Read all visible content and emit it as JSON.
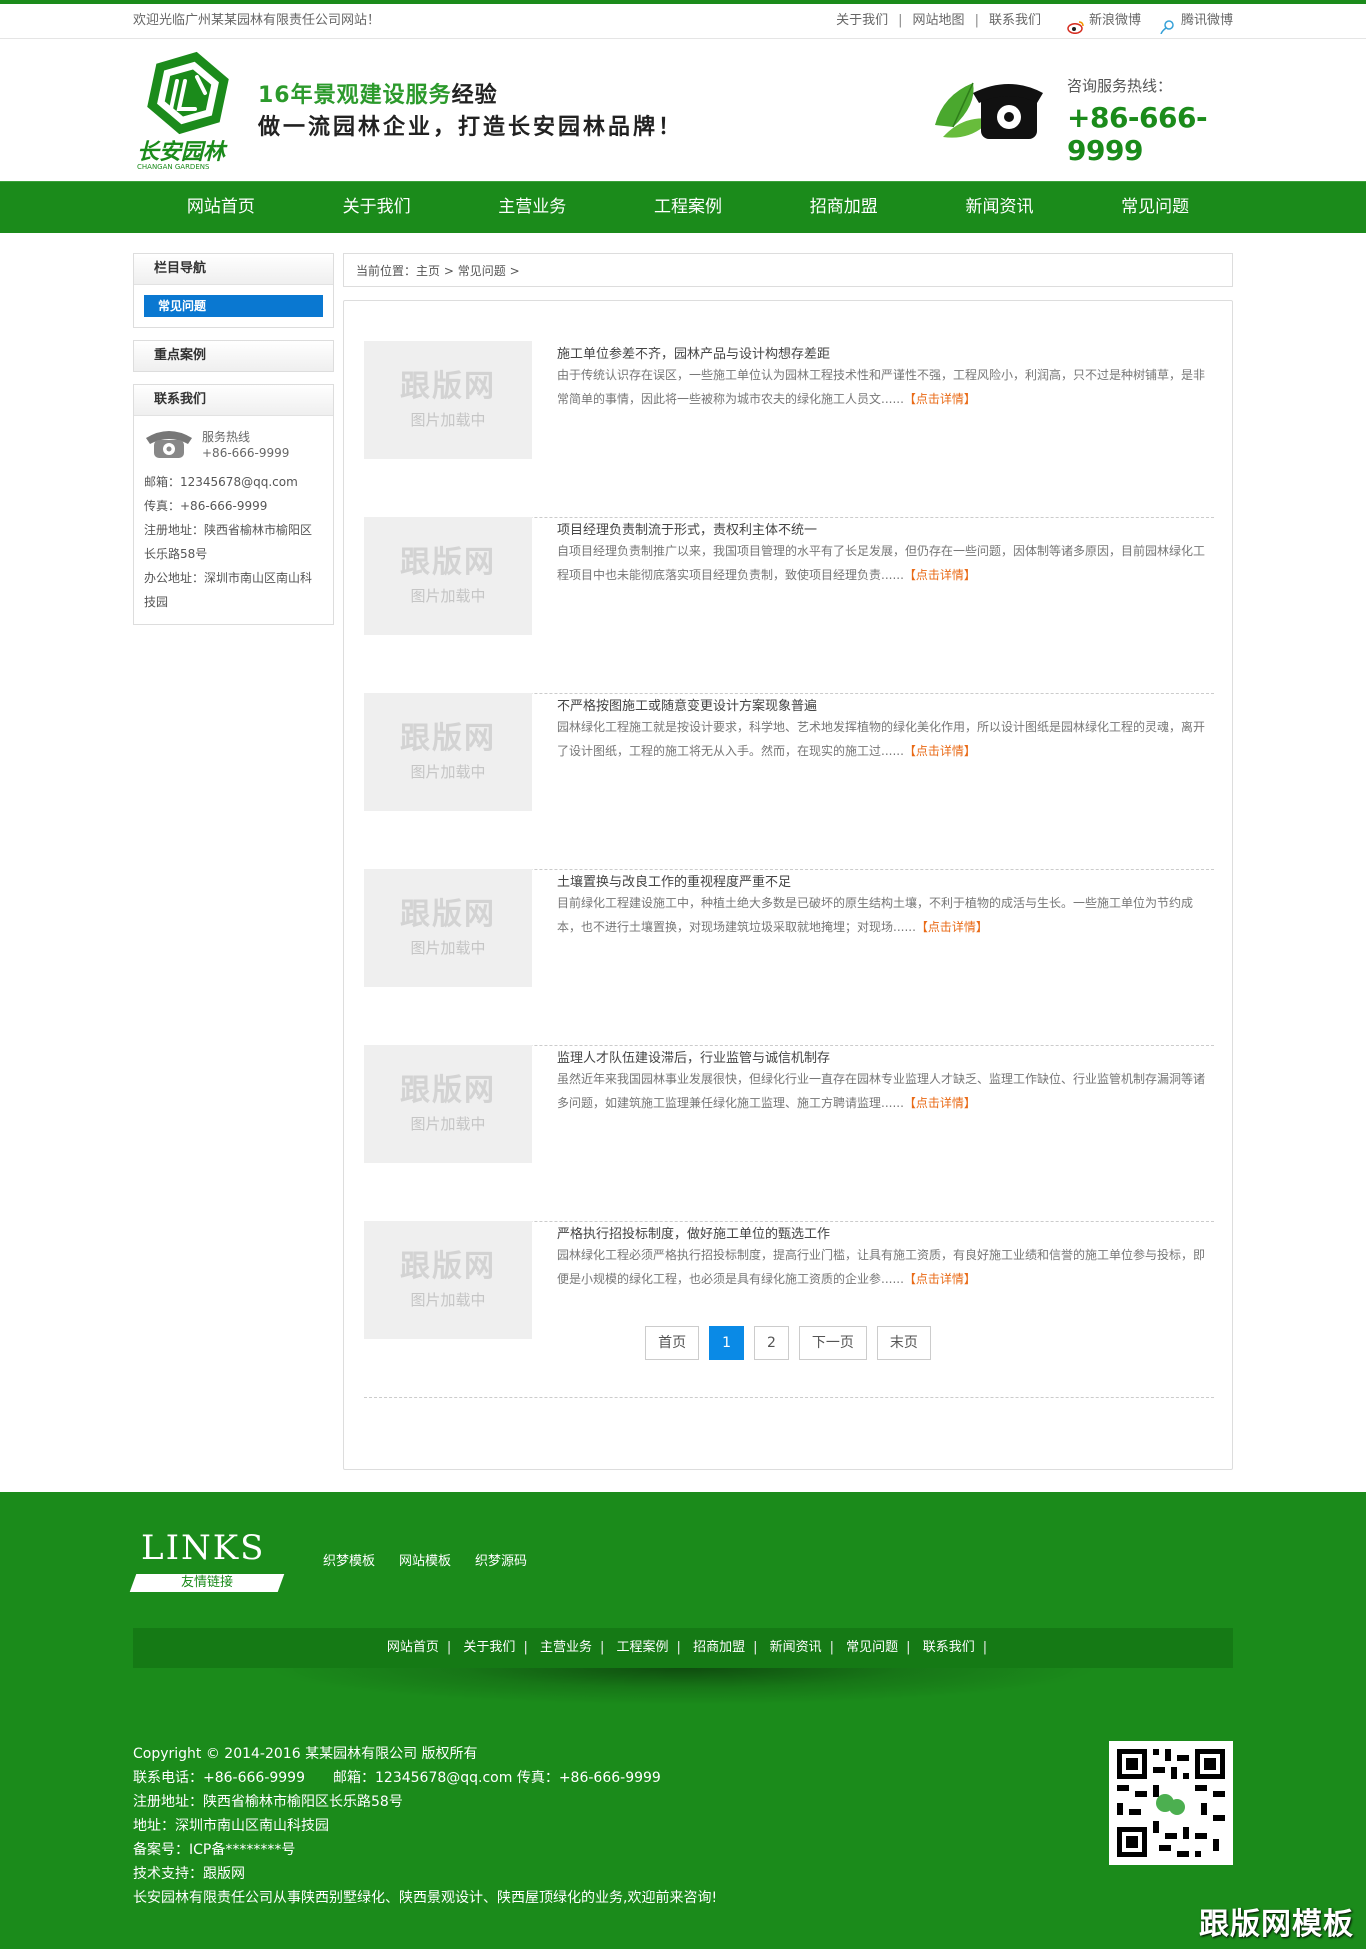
{
  "topbar": {
    "welcome": "欢迎光临广州某某园林有限责任公司网站！",
    "links": [
      "关于我们",
      "网站地图",
      "联系我们"
    ],
    "separator": "|",
    "weibo_sina": "新浪微博",
    "weibo_tencent": "腾讯微博"
  },
  "header": {
    "logo_text": "长安园林",
    "logo_sub": "CHANGAN GARDENS",
    "slogan_line1_a": "16年景观建设服务",
    "slogan_line1_b": "经验",
    "slogan_line2": "做一流园林企业，打造长安园林品牌！",
    "hotline_label": "咨询服务热线：",
    "hotline_number": "+86-666-9999"
  },
  "nav": [
    "网站首页",
    "关于我们",
    "主营业务",
    "工程案例",
    "招商加盟",
    "新闻资讯",
    "常见问题"
  ],
  "sidebar": {
    "nav_title": "栏目导航",
    "nav_current": "常见问题",
    "cases_title": "重点案例",
    "contact_title": "联系我们",
    "service_label": "服务热线",
    "service_phone": "+86-666-9999",
    "lines": [
      "邮箱：12345678@qq.com",
      "传真：+86-666-9999",
      "注册地址：陕西省榆林市榆阳区长乐路58号",
      "办公地址：深圳市南山区南山科技园"
    ]
  },
  "breadcrumb": {
    "prefix": "当前位置：",
    "home": "主页",
    "sep": ">",
    "current": "常见问题",
    "tail": ">"
  },
  "thumb_placeholder": {
    "line1": "跟版网",
    "line2": "图片加载中"
  },
  "more_label": "【点击详情】",
  "articles": [
    {
      "title": "施工单位参差不齐，园林产品与设计构想存差距",
      "summary": "由于传统认识存在误区，一些施工单位认为园林工程技术性和严谨性不强，工程风险小，利润高，只不过是种树铺草，是非常简单的事情，因此将一些被称为城市农夫的绿化施工人员文......"
    },
    {
      "title": "项目经理负责制流于形式，责权利主体不统一",
      "summary": "自项目经理负责制推广以来，我国项目管理的水平有了长足发展，但仍存在一些问题，因体制等诸多原因，目前园林绿化工程项目中也未能彻底落实项目经理负责制，致使项目经理负责......"
    },
    {
      "title": "不严格按图施工或随意变更设计方案现象普遍",
      "summary": "园林绿化工程施工就是按设计要求，科学地、艺术地发挥植物的绿化美化作用，所以设计图纸是园林绿化工程的灵魂，离开了设计图纸，工程的施工将无从入手。然而，在现实的施工过......"
    },
    {
      "title": "土壤置换与改良工作的重视程度严重不足",
      "summary": "目前绿化工程建设施工中，种植土绝大多数是已破坏的原生结构土壤，不利于植物的成活与生长。一些施工单位为节约成本，也不进行土壤置换，对现场建筑垃圾采取就地掩埋；对现场......"
    },
    {
      "title": "监理人才队伍建设滞后，行业监管与诚信机制存",
      "summary": "虽然近年来我国园林事业发展很快，但绿化行业一直存在园林专业监理人才缺乏、监理工作缺位、行业监管机制存漏洞等诸多问题，如建筑施工监理兼任绿化施工监理、施工方聘请监理......"
    },
    {
      "title": "严格执行招投标制度，做好施工单位的甄选工作",
      "summary": "园林绿化工程必须严格执行招投标制度，提高行业门槛，让具有施工资质，有良好施工业绩和信誉的施工单位参与投标，即便是小规模的绿化工程，也必须是具有绿化施工资质的企业参......"
    }
  ],
  "pager": {
    "first": "首页",
    "pages": [
      "1",
      "2"
    ],
    "current": "1",
    "next": "下一页",
    "last": "末页"
  },
  "footer": {
    "links_title": "LINKS",
    "links_sub": "友情链接",
    "friend_links": [
      "织梦模板",
      "网站模板",
      "织梦源码"
    ],
    "nav": [
      "网站首页",
      "关于我们",
      "主营业务",
      "工程案例",
      "招商加盟",
      "新闻资讯",
      "常见问题",
      "联系我们"
    ],
    "nav_sep": "|",
    "info": [
      "Copyright © 2014-2016 某某园林有限公司 版权所有",
      "联系电话：+86-666-9999　　邮箱：12345678@qq.com 传真：+86-666-9999",
      "注册地址：陕西省榆林市榆阳区长乐路58号",
      "地址：深圳市南山区南山科技园",
      "备案号：ICP备********号",
      "技术支持：跟版网",
      "长安园林有限责任公司从事陕西别墅绿化、陕西景观设计、陕西屋顶绿化的业务,欢迎前来咨询!"
    ],
    "watermark": "跟版网模板"
  },
  "colors": {
    "brand_green": "#1b8b1b",
    "active_blue": "#0a78d1",
    "more_orange": "#e96a16"
  }
}
